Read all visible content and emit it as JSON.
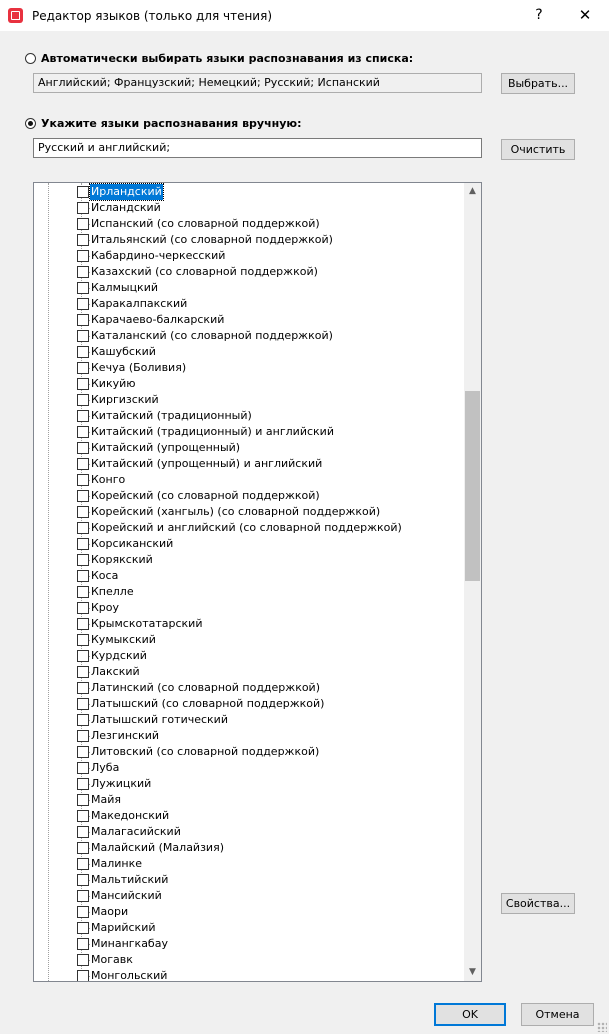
{
  "window": {
    "title": "Редактор языков (только для чтения)",
    "help_glyph": "?",
    "close_glyph": "✕"
  },
  "auto": {
    "label": "Автоматически выбирать языки распознавания из списка:",
    "value": "Английский; Французский; Немецкий; Русский; Испанский",
    "button": "Выбрать..."
  },
  "manual": {
    "label": "Укажите языки распознавания вручную:",
    "value": "Русский и английский;",
    "button": "Очистить"
  },
  "languages": [
    "Ирландский",
    "Исландский",
    "Испанский (со словарной поддержкой)",
    "Итальянский (со словарной поддержкой)",
    "Кабардино-черкесский",
    "Казахский (со словарной поддержкой)",
    "Калмыцкий",
    "Каракалпакский",
    "Карачаево-балкарский",
    "Каталанский (со словарной поддержкой)",
    "Кашубский",
    "Кечуа (Боливия)",
    "Кикуйю",
    "Киргизский",
    "Китайский (традиционный)",
    "Китайский (традиционный) и английский",
    "Китайский (упрощенный)",
    "Китайский (упрощенный) и английский",
    "Конго",
    "Корейский (со словарной поддержкой)",
    "Корейский (хангыль) (со словарной поддержкой)",
    "Корейский и английский (со словарной поддержкой)",
    "Корсиканский",
    "Корякский",
    "Коса",
    "Кпелле",
    "Кроу",
    "Крымскотатарский",
    "Кумыкский",
    "Курдский",
    "Лакский",
    "Латинский (со словарной поддержкой)",
    "Латышский (со словарной поддержкой)",
    "Латышский готический",
    "Лезгинский",
    "Литовский (со словарной поддержкой)",
    "Луба",
    "Лужицкий",
    "Майя",
    "Македонский",
    "Малагасийский",
    "Малайский (Малайзия)",
    "Малинке",
    "Мальтийский",
    "Мансийский",
    "Маори",
    "Марийский",
    "Минангкабау",
    "Могавк",
    "Монгольский"
  ],
  "selected_language": "Ирландский",
  "properties_button": "Свойства...",
  "ok_button": "OK",
  "cancel_button": "Отмена",
  "scrollbar": {
    "up_glyph": "▲",
    "down_glyph": "▼"
  }
}
